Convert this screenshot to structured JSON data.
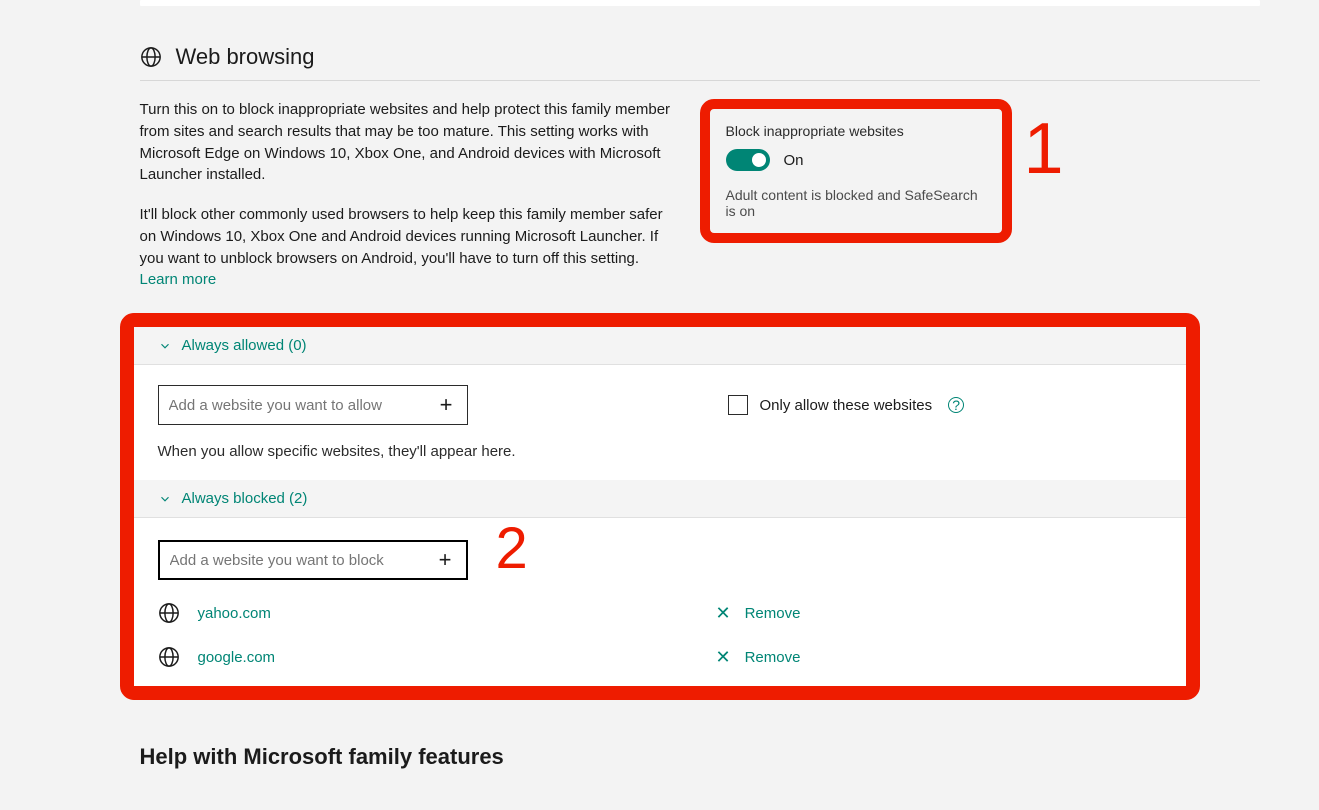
{
  "section": {
    "title": "Web browsing",
    "desc1": "Turn this on to block inappropriate websites and help protect this family member from sites and search results that may be too mature. This setting works with Microsoft Edge on Windows 10, Xbox One, and Android devices with Microsoft Launcher installed.",
    "desc2_pre": "It'll block other commonly used browsers to help keep this family member safer on Windows 10, Xbox One and Android devices running Microsoft Launcher. If you want to unblock browsers on Android, you'll have to turn off this setting.  ",
    "learn_more": "Learn more"
  },
  "blockbox": {
    "title": "Block inappropriate websites",
    "state": "On",
    "sub": "Adult content is blocked and SafeSearch is on"
  },
  "annotations": {
    "one": "1",
    "two": "2"
  },
  "allowed": {
    "header": "Always allowed (0)",
    "placeholder": "Add a website you want to allow",
    "hint": "When you allow specific websites, they'll appear here.",
    "only_label": "Only allow these websites"
  },
  "blocked": {
    "header": "Always blocked (2)",
    "placeholder": "Add a website you want to block",
    "remove_label": "Remove",
    "sites": [
      "yahoo.com",
      "google.com"
    ]
  },
  "help_heading": "Help with Microsoft family features"
}
